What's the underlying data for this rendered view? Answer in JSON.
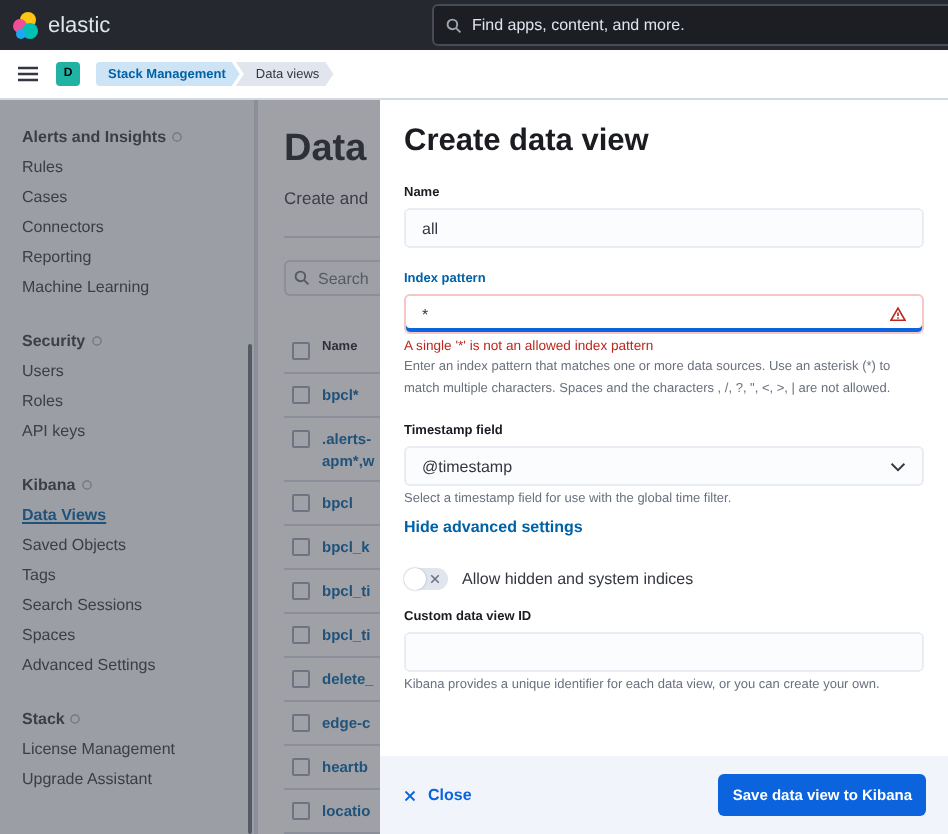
{
  "header": {
    "logo_text": "elastic",
    "search": {
      "placeholder": "Find apps, content, and more."
    }
  },
  "breadcrumb_bar": {
    "avatar": "D",
    "crumbs": [
      {
        "label": "Stack Management",
        "selected": false
      },
      {
        "label": "Data views",
        "selected": true
      }
    ]
  },
  "sidebar": {
    "sections": [
      {
        "title": "Alerts and Insights",
        "items": [
          {
            "label": "Rules",
            "selected": false
          },
          {
            "label": "Cases",
            "selected": false
          },
          {
            "label": "Connectors",
            "selected": false
          },
          {
            "label": "Reporting",
            "selected": false
          },
          {
            "label": "Machine Learning",
            "selected": false
          }
        ]
      },
      {
        "title": "Security",
        "items": [
          {
            "label": "Users",
            "selected": false
          },
          {
            "label": "Roles",
            "selected": false
          },
          {
            "label": "API keys",
            "selected": false
          }
        ]
      },
      {
        "title": "Kibana",
        "items": [
          {
            "label": "Data Views",
            "selected": true
          },
          {
            "label": "Saved Objects",
            "selected": false
          },
          {
            "label": "Tags",
            "selected": false
          },
          {
            "label": "Search Sessions",
            "selected": false
          },
          {
            "label": "Spaces",
            "selected": false
          },
          {
            "label": "Advanced Settings",
            "selected": false
          }
        ]
      },
      {
        "title": "Stack",
        "items": [
          {
            "label": "License Management",
            "selected": false
          },
          {
            "label": "Upgrade Assistant",
            "selected": false
          }
        ]
      }
    ]
  },
  "main": {
    "title": "Data",
    "subtitle": "Create and",
    "search": {
      "placeholder": "Search"
    },
    "table": {
      "columns": [
        "Name"
      ],
      "all_checked": false,
      "rows": [
        {
          "lines": [
            "bpcl*"
          ],
          "checked": false
        },
        {
          "lines": [
            ".alerts-",
            "apm*,w"
          ],
          "checked": false
        },
        {
          "lines": [
            "bpcl"
          ],
          "checked": false
        },
        {
          "lines": [
            "bpcl_k"
          ],
          "checked": false
        },
        {
          "lines": [
            "bpcl_ti"
          ],
          "checked": false
        },
        {
          "lines": [
            "bpcl_ti"
          ],
          "checked": false
        },
        {
          "lines": [
            "delete_"
          ],
          "checked": false
        },
        {
          "lines": [
            "edge-c"
          ],
          "checked": false
        },
        {
          "lines": [
            "heartb"
          ],
          "checked": false
        },
        {
          "lines": [
            "locatio"
          ],
          "checked": false
        }
      ]
    }
  },
  "flyout": {
    "title": "Create data view",
    "fields": [
      {
        "kind": "text",
        "label": "Name",
        "value": "all",
        "focused": false,
        "invalid": false
      },
      {
        "kind": "text",
        "label": "Index pattern",
        "value": "*",
        "focused": true,
        "invalid": true,
        "error": "A single '*' is not an allowed index pattern",
        "help": "Enter an index pattern that matches one or more data sources. Use an asterisk (*) to match multiple characters. Spaces and the characters , /, ?, \", <, >, | are not allowed."
      },
      {
        "kind": "select",
        "label": "Timestamp field",
        "value": "@timestamp",
        "focused": false,
        "invalid": false,
        "help": "Select a timestamp field for use with the global time filter."
      },
      {
        "kind": "link",
        "label": "Hide advanced settings"
      },
      {
        "kind": "toggle",
        "label": "Allow hidden and system indices",
        "on": false
      },
      {
        "kind": "text",
        "label": "Custom data view ID",
        "focused": false,
        "invalid": false,
        "help": "Kibana provides a unique identifier for each data view, or you can create your own."
      }
    ],
    "footer": {
      "close": "Close",
      "save": "Save data view to Kibana"
    }
  }
}
